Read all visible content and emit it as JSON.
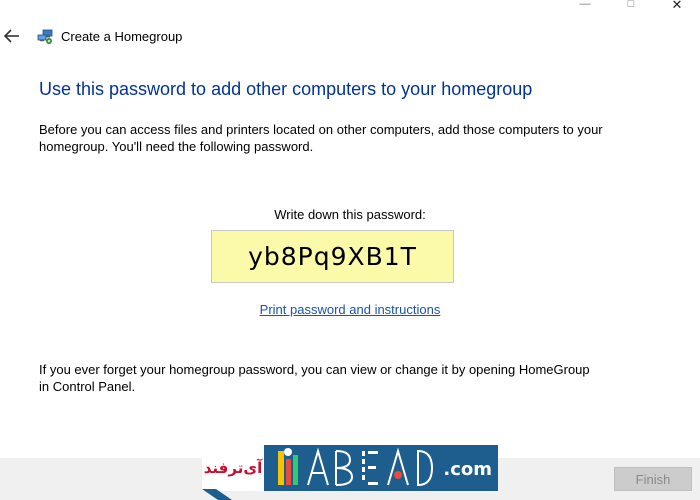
{
  "window": {
    "title": "Create a Homegroup",
    "controls": {
      "minimize": "—",
      "maximize": "□",
      "close": "✕"
    }
  },
  "icons": {
    "back": "arrow-left",
    "homegroup": "homegroup-network-icon"
  },
  "content": {
    "heading": "Use this password to add other computers to your homegroup",
    "intro": "Before you can access files and printers located on other computers, add those computers to your homegroup. You'll need the following password.",
    "password_label": "Write down this password:",
    "password": "yb8Pq9XB1T",
    "print_link": "Print password and instructions",
    "forgot_note": "If you ever forget your homegroup password, you can view or change it by opening HomeGroup in Control Panel."
  },
  "footer": {
    "finish_label": "Finish",
    "finish_enabled": false
  },
  "watermark": {
    "left_text": "آی‌ترفند",
    "right_text": ".com"
  },
  "colors": {
    "heading": "#003399",
    "link": "#1a52ad",
    "password_bg": "#fafaa8",
    "footer_bg": "#f0f0f0",
    "watermark_blue": "#1e5e8f",
    "watermark_red": "#c8102e"
  }
}
